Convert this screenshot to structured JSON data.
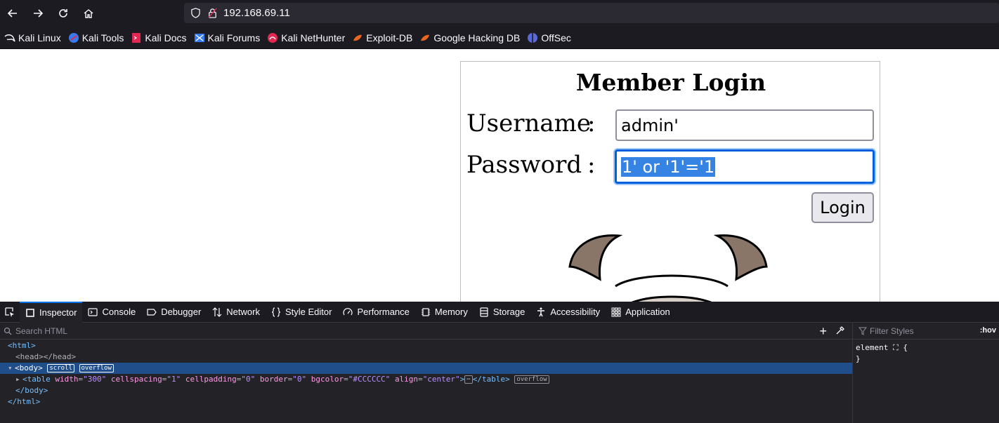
{
  "browser": {
    "url": "192.168.69.11",
    "bookmarks": [
      {
        "label": "Kali Linux",
        "icon": "kali-dragon-icon"
      },
      {
        "label": "Kali Tools",
        "icon": "kali-tools-icon"
      },
      {
        "label": "Kali Docs",
        "icon": "kali-docs-icon"
      },
      {
        "label": "Kali Forums",
        "icon": "kali-forums-icon"
      },
      {
        "label": "Kali NetHunter",
        "icon": "kali-nethunter-icon"
      },
      {
        "label": "Exploit-DB",
        "icon": "exploit-db-icon"
      },
      {
        "label": "Google Hacking DB",
        "icon": "ghdb-icon"
      },
      {
        "label": "OffSec",
        "icon": "offsec-icon"
      }
    ]
  },
  "page": {
    "title": "Member Login",
    "username_label": "Username",
    "password_label": "Password",
    "colon": ":",
    "username_value": "admin'",
    "password_value": "1' or '1'='1",
    "login_button": "Login"
  },
  "devtools": {
    "tabs": [
      "Inspector",
      "Console",
      "Debugger",
      "Network",
      "Style Editor",
      "Performance",
      "Memory",
      "Storage",
      "Accessibility",
      "Application"
    ],
    "search_placeholder": "Search HTML",
    "filter_placeholder": "Filter Styles",
    "hov_label": ":hov",
    "styles_rule_selector": "element",
    "styles_rule_open": "{",
    "styles_rule_close": "}",
    "tree": {
      "html_open": "<html>",
      "head": "<head></head>",
      "body_open": "<body>",
      "badge_scroll": "scroll",
      "badge_overflow": "overflow",
      "table_tag": "<table",
      "table_attrs": [
        {
          "name": "width",
          "value": "\"300\""
        },
        {
          "name": "cellspacing",
          "value": "\"1\""
        },
        {
          "name": "cellpadding",
          "value": "\"0\""
        },
        {
          "name": "border",
          "value": "\"0\""
        },
        {
          "name": "bgcolor",
          "value": "\"#CCCCCC\""
        },
        {
          "name": "align",
          "value": "\"center\""
        }
      ],
      "table_close_bracket": ">",
      "ellipsis": "⋯",
      "table_end": "</table>",
      "body_close": "</body>",
      "html_close": "</html>"
    }
  },
  "colors": {
    "toolbar_bg": "#1c1b22",
    "url_bg": "#2b2a33",
    "devtools_bg": "#232327",
    "selection": "#3584e4",
    "focus_ring": "#0060df",
    "selected_row": "#204e8a"
  }
}
